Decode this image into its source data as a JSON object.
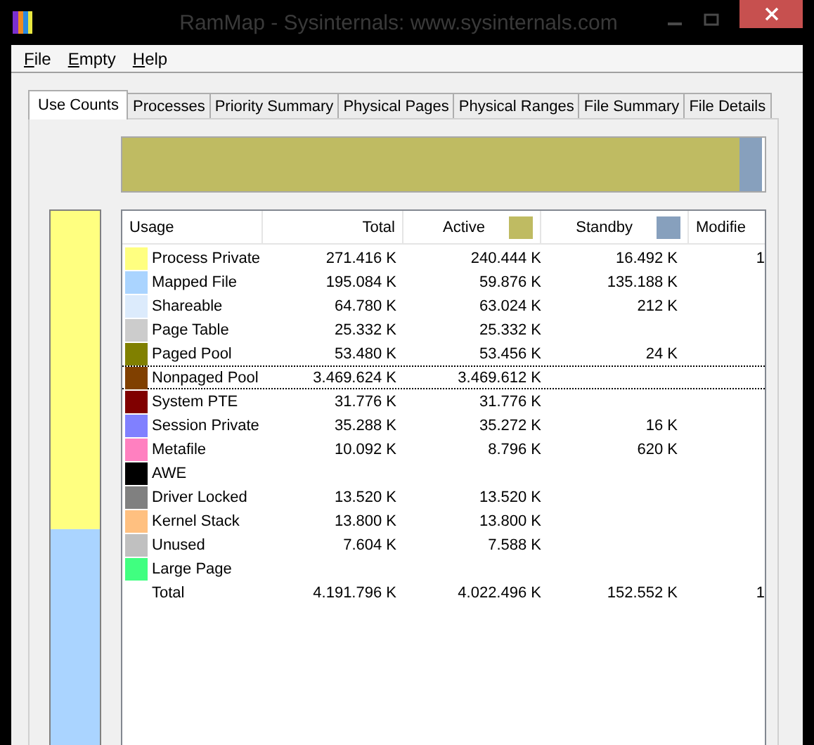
{
  "window": {
    "title": "RamMap - Sysinternals: www.sysinternals.com"
  },
  "menu": [
    {
      "label": "File",
      "underline_first": true
    },
    {
      "label": "Empty",
      "underline_first": true
    },
    {
      "label": "Help",
      "underline_first": true
    }
  ],
  "tabs": [
    {
      "label": "Use Counts",
      "selected": true
    },
    {
      "label": "Processes",
      "selected": false
    },
    {
      "label": "Priority Summary",
      "selected": false
    },
    {
      "label": "Physical Pages",
      "selected": false
    },
    {
      "label": "Physical Ranges",
      "selected": false
    },
    {
      "label": "File Summary",
      "selected": false
    },
    {
      "label": "File Details",
      "selected": false
    }
  ],
  "columns": [
    {
      "label": "Usage"
    },
    {
      "label": "Total"
    },
    {
      "label": "Active",
      "color": "#bfbb62"
    },
    {
      "label": "Standby",
      "color": "#87a0bd"
    },
    {
      "label": "Modifie"
    }
  ],
  "list_bar": [
    {
      "color": "#bfbb62",
      "level": 0.96
    },
    {
      "color": "#87a0bd",
      "level": 0.036
    }
  ],
  "rows": [
    {
      "kind": "category",
      "name": "Process Private",
      "color": "#ffff80",
      "focused": false,
      "total": "271.416 K",
      "active": "240.444 K",
      "standby": "16.492 K",
      "modified": "1"
    },
    {
      "kind": "category",
      "name": "Mapped File",
      "color": "#aad4ff",
      "focused": false,
      "total": "195.084 K",
      "active": "59.876 K",
      "standby": "135.188 K"
    },
    {
      "kind": "category",
      "name": "Shareable",
      "color": "#dcebfc",
      "focused": false,
      "total": "64.780 K",
      "active": "63.024 K",
      "standby": "212 K"
    },
    {
      "kind": "category",
      "name": "Page Table",
      "color": "#cccccc",
      "focused": false,
      "total": "25.332 K",
      "active": "25.332 K"
    },
    {
      "kind": "category",
      "name": "Paged Pool",
      "color": "#808000",
      "focused": false,
      "total": "53.480 K",
      "active": "53.456 K",
      "standby": "24 K"
    },
    {
      "kind": "category",
      "name": "Nonpaged Pool",
      "color": "#804000",
      "focused": true,
      "total": "3.469.624 K",
      "active": "3.469.612 K"
    },
    {
      "kind": "category",
      "name": "System PTE",
      "color": "#800000",
      "focused": false,
      "total": "31.776 K",
      "active": "31.776 K"
    },
    {
      "kind": "category",
      "name": "Session Private",
      "color": "#8080ff",
      "focused": false,
      "total": "35.288 K",
      "active": "35.272 K",
      "standby": "16 K"
    },
    {
      "kind": "category",
      "name": "Metafile",
      "color": "#ff80c0",
      "focused": false,
      "total": "10.092 K",
      "active": "8.796 K",
      "standby": "620 K"
    },
    {
      "kind": "category",
      "name": "AWE",
      "color": "#000000",
      "focused": false
    },
    {
      "kind": "category",
      "name": "Driver Locked",
      "color": "#808080",
      "focused": false,
      "total": "13.520 K",
      "active": "13.520 K"
    },
    {
      "kind": "category",
      "name": "Kernel Stack",
      "color": "#ffc080",
      "focused": false,
      "total": "13.800 K",
      "active": "13.800 K"
    },
    {
      "kind": "category",
      "name": "Unused",
      "color": "#c0c0c0",
      "focused": false,
      "total": "7.604 K",
      "active": "7.588 K"
    },
    {
      "kind": "category",
      "name": "Large Page",
      "color": "#40ff80",
      "focused": false
    },
    {
      "kind": "total",
      "name": "Total",
      "focused": false,
      "total": "4.191.796 K",
      "active": "4.022.496 K",
      "standby": "152.552 K",
      "modified": "1"
    }
  ]
}
